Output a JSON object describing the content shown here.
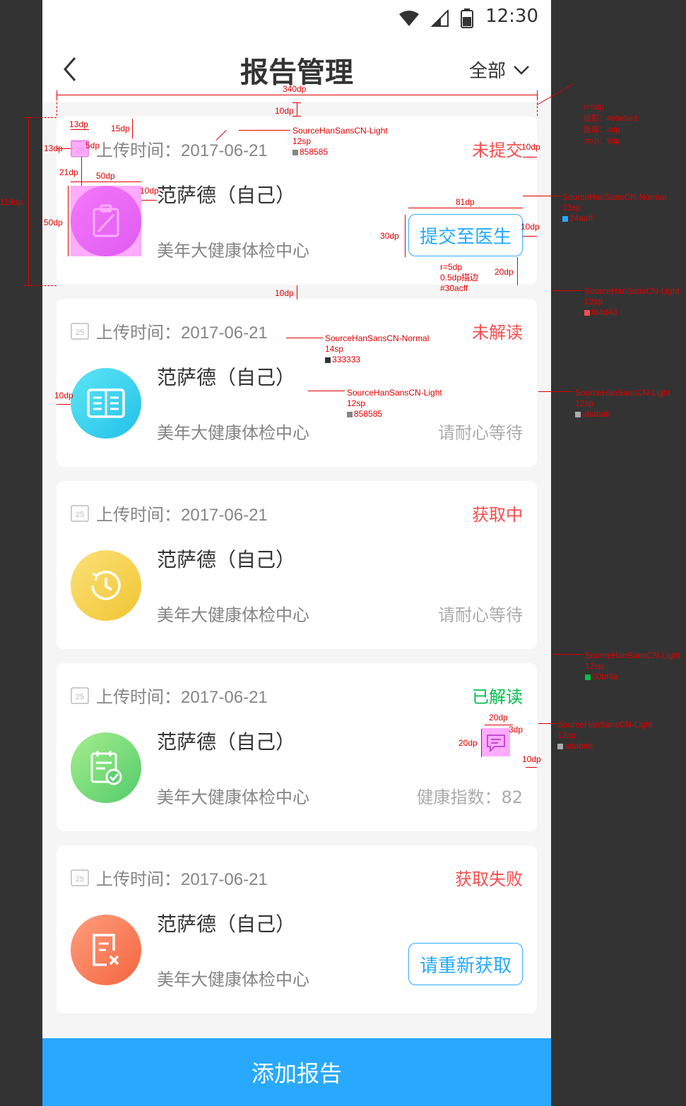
{
  "status_bar": {
    "time": "12:30"
  },
  "header": {
    "title": "报告管理",
    "filter_label": "全部"
  },
  "cards": [
    {
      "date_icon": "25",
      "upload_time": "上传时间：2017-06-21",
      "status": "未提交",
      "status_color": "#f84d4d",
      "patient": "范萨德（自己）",
      "center": "美年大健康体检中心",
      "action": "提交至医生",
      "avatar_icon": "clipboard-icon",
      "avatar_gradient": [
        "#e78ef0",
        "#b94de2"
      ]
    },
    {
      "date_icon": "25",
      "upload_time": "上传时间：2017-06-21",
      "status": "未解读",
      "status_color": "#f84d4d",
      "patient": "范萨德（自己）",
      "center": "美年大健康体检中心",
      "note": "请耐心等待",
      "avatar_icon": "book-icon",
      "avatar_gradient": [
        "#5ee6f4",
        "#22c1e9"
      ]
    },
    {
      "date_icon": "25",
      "upload_time": "上传时间：2017-06-21",
      "status": "获取中",
      "status_color": "#f84d4d",
      "patient": "范萨德（自己）",
      "center": "美年大健康体检中心",
      "note": "请耐心等待",
      "avatar_icon": "clock-icon",
      "avatar_gradient": [
        "#fbe17a",
        "#f0c531"
      ]
    },
    {
      "date_icon": "25",
      "upload_time": "上传时间：2017-06-21",
      "status": "已解读",
      "status_color": "#00bf4e",
      "patient": "范萨德（自己）",
      "center": "美年大健康体检中心",
      "note": "健康指数：82",
      "avatar_icon": "checklist-icon",
      "avatar_gradient": [
        "#a6ee8e",
        "#52cb6a"
      ]
    },
    {
      "date_icon": "25",
      "upload_time": "上传时间：2017-06-21",
      "status": "获取失败",
      "status_color": "#f84d4d",
      "patient": "范萨德（自己）",
      "center": "美年大健康体检中心",
      "action": "请重新获取",
      "avatar_icon": "document-x-icon",
      "avatar_gradient": [
        "#fd9e7d",
        "#f5653f"
      ]
    }
  ],
  "bottom_button": {
    "label": "添加报告"
  },
  "annotations": {
    "width_340": "340dp",
    "gap_10_top": "10dp",
    "gap_10_mid": "10dp",
    "h119": "119dp",
    "a13_left": "13dp",
    "a13_top": "13dp",
    "a15": "15dp",
    "a5": "5dp",
    "a21": "21dp",
    "a50w": "50dp",
    "a50h": "50dp",
    "a10_avatar": "10dp",
    "font_light_12": [
      "SourceHanSansCN-Light",
      "12sp",
      "858585"
    ],
    "card_style": [
      "r=5dp",
      "投影：#e9ebed",
      "距离：4dp",
      "大小：9dp"
    ],
    "status_10": "10dp",
    "btn_font": [
      "SourceHanSansCN-Normal",
      "13sp",
      "24aaff"
    ],
    "btn_w81": "81dp",
    "btn_h30": "30dp",
    "btn_right10": "10dp",
    "btn_bottom20": "20dp",
    "btn_border": [
      "r=5dp",
      "0.5dp描边",
      "#30acff"
    ],
    "status_font": [
      "SourceHanSansCN-Light",
      "12sp",
      "f84d4d"
    ],
    "name_font": [
      "SourceHanSansCN-Normal",
      "14sp",
      "333333"
    ],
    "center_font": [
      "SourceHanSansCN-Light",
      "12sp",
      "858585"
    ],
    "note_font": [
      "SourceHanSansCN-Light",
      "12sp",
      "ababab"
    ],
    "left10": "10dp",
    "read_font": [
      "SourceHanSansCN-Light",
      "12sp",
      "00bf4e"
    ],
    "chat20w": "20dp",
    "chat20h": "20dp",
    "chat3": "3dp",
    "chat10": "10dp",
    "chat_font": [
      "SourceHanSansCN-Light",
      "12sp",
      "ababab"
    ]
  }
}
